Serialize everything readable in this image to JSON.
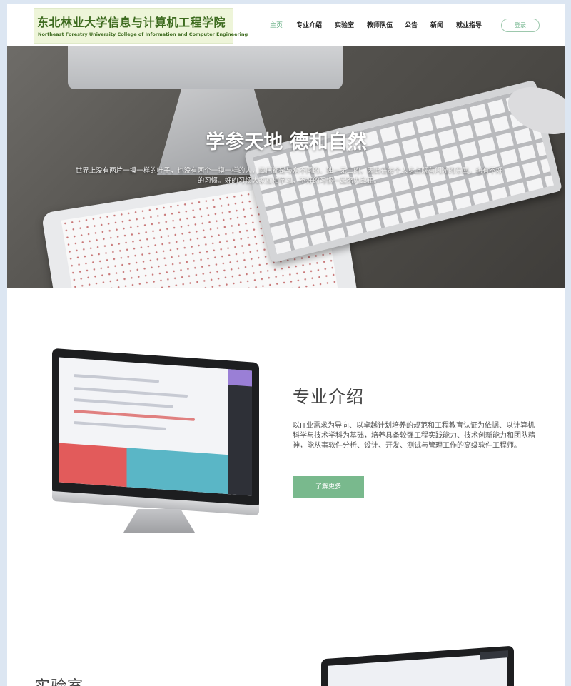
{
  "header": {
    "logo_cn": "东北林业大学信息与计算机工程学院",
    "logo_en": "Northeast Forestry University  College of Information and Computer Engineering",
    "nav": [
      {
        "label": "主页",
        "active": true
      },
      {
        "label": "专业介绍",
        "active": false
      },
      {
        "label": "实验室",
        "active": false
      },
      {
        "label": "教师队伍",
        "active": false
      },
      {
        "label": "公告",
        "active": false
      },
      {
        "label": "新闻",
        "active": false
      },
      {
        "label": "就业指导",
        "active": false
      }
    ],
    "login_label": "登录"
  },
  "hero": {
    "title": "学参天地 德和自然",
    "text": "世界上没有两片一摸一样的叶子，也没有两个一摸一样的人，我们都是与众不同的、独一无二的，因此在每个人身上既有闪光的东西，也有不好的习惯。好的习惯大家互相学习，不好的习惯一起努力改正。"
  },
  "intro": {
    "title": "专业介绍",
    "text": "以IT业需求为导向、以卓越计划培养的规范和工程教育认证为依据、以计算机科学与技术学科为基础，培养具备较强工程实践能力、技术创新能力和团队精神，能从事软件分析、设计、开发、测试与管理工作的高级软件工程师。",
    "button_label": "了解更多"
  },
  "lab": {
    "title": "实验室"
  },
  "colors": {
    "accent": "#5aa87a",
    "button": "#79b98d",
    "logo_bg": "#eef5d9",
    "logo_text": "#3d6b1f"
  }
}
